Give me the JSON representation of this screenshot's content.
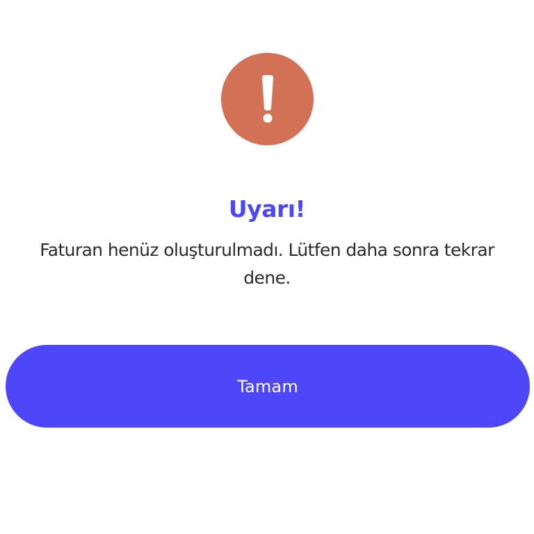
{
  "colors": {
    "alert_circle": "#D17156",
    "alert_glyph": "#FFFFFF",
    "accent": "#4D47F9",
    "text": "#2C2A2D",
    "background": "#FFFFFF"
  },
  "alert": {
    "icon": "exclamation-circle-icon",
    "title": "Uyarı!",
    "message_line_1": "Faturan henüz oluşturulmadı. Lütfen daha sonra tekrar",
    "message_line_2": "dene."
  },
  "actions": {
    "ok_label": "Tamam"
  }
}
